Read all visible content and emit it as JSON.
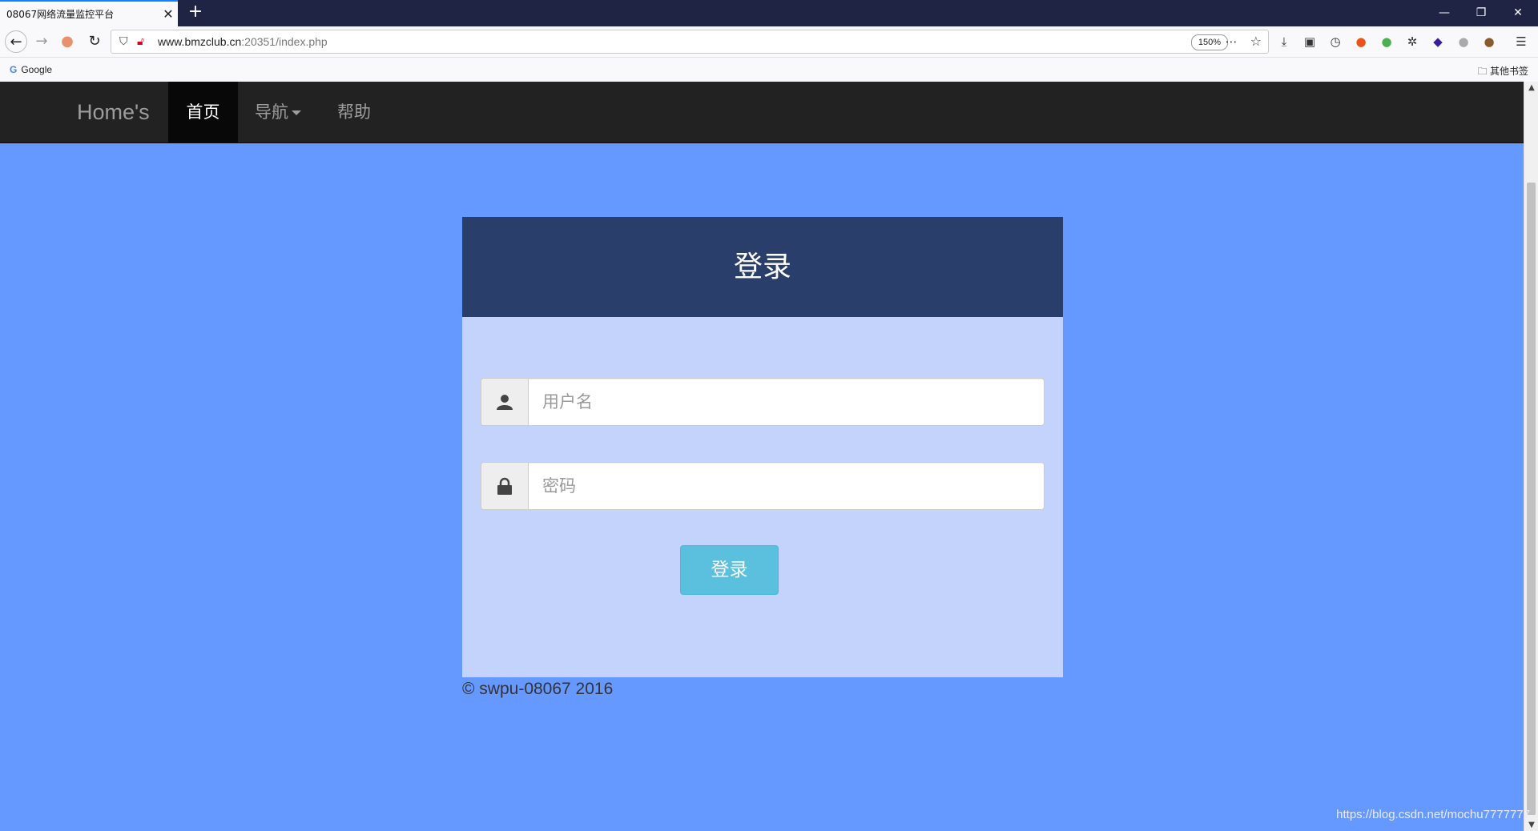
{
  "browser": {
    "tab_title": "08067网络流量监控平台",
    "tab_close": "✕",
    "new_tab": "+",
    "url_host": "www.bmzclub.cn",
    "url_path": ":20351/index.php",
    "zoom": "150%",
    "bookmarks": {
      "google": "Google",
      "other": "其他书签"
    }
  },
  "site": {
    "brand": "Home's",
    "nav": [
      {
        "label": "首页",
        "active": true
      },
      {
        "label": "导航",
        "dropdown": true
      },
      {
        "label": "帮助"
      }
    ]
  },
  "login": {
    "title": "登录",
    "username_placeholder": "用户名",
    "password_placeholder": "密码",
    "submit_label": "登录"
  },
  "footer": {
    "text": "© swpu-08067 2016"
  },
  "watermark": "https://blog.csdn.net/mochu7777777",
  "colors": {
    "page_bg": "#6699ff",
    "panel_bg": "#c3d3fc",
    "panel_header": "#293e6a",
    "navbar": "#222222",
    "button": "#5bc0de"
  }
}
